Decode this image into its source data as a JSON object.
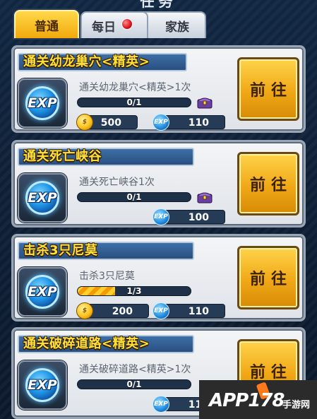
{
  "header": {
    "title": "任务"
  },
  "tabs": [
    {
      "label": "普通",
      "active": true
    },
    {
      "label": "每日",
      "active": false,
      "has_badge": true
    },
    {
      "label": "家族",
      "active": false
    }
  ],
  "tasks": [
    {
      "title": "通关幼龙巢穴<精英>",
      "desc": "通关幼龙巢穴<精英>1次",
      "progress_text": "0/1",
      "progress_fraction": 0,
      "coin": "500",
      "exp": "110",
      "button": "前往",
      "icon": "exp-icon"
    },
    {
      "title": "通关死亡峡谷",
      "desc": "通关死亡峡谷1次",
      "progress_text": "0/1",
      "progress_fraction": 0,
      "coin": "",
      "exp": "100",
      "button": "前往",
      "icon": "exp-icon"
    },
    {
      "title": "击杀3只尼莫",
      "desc": "击杀3只尼莫",
      "progress_text": "1/3",
      "progress_fraction": 0.333,
      "coin": "200",
      "exp": "110",
      "button": "前往",
      "icon": "exp-icon"
    },
    {
      "title": "通关破碎道路<精英>",
      "desc": "通关破碎道路<精英>1次",
      "progress_text": "0/1",
      "progress_fraction": 0,
      "coin": "",
      "exp": "110",
      "button": "前往",
      "icon": "exp-icon"
    }
  ],
  "icon_labels": {
    "exp": "EXP",
    "exp_small": "EXP"
  },
  "watermark": {
    "text": "APP178",
    "sub": "手游网"
  },
  "colors": {
    "accent": "#f2a90c",
    "title_yellow": "#ffe13a",
    "bar_bg": "#1f3148"
  }
}
